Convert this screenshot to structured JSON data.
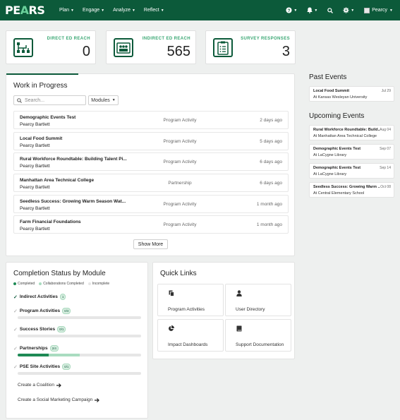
{
  "nav": {
    "logo_main": "PE",
    "logo_accent": "A",
    "logo_end": "RS",
    "menu": [
      {
        "label": "Plan"
      },
      {
        "label": "Engage"
      },
      {
        "label": "Analyze"
      },
      {
        "label": "Reflect"
      }
    ],
    "user_name": "Pearcy"
  },
  "stats": [
    {
      "label": "DIRECT ED REACH",
      "value": "0",
      "icon": "workflow-icon"
    },
    {
      "label": "INDIRECT ED REACH",
      "value": "565",
      "icon": "group-icon"
    },
    {
      "label": "SURVEY RESPONSES",
      "value": "3",
      "icon": "clipboard-icon"
    }
  ],
  "wip": {
    "title": "Work in Progress",
    "search_placeholder": "Search...",
    "filter_label": "Modules",
    "rows": [
      {
        "name": "Demographic Events Test",
        "owner": "Pearcy Bartlett",
        "type": "Program Activity",
        "time": "2 days ago"
      },
      {
        "name": "Local Food Summit",
        "owner": "Pearcy Bartlett",
        "type": "Program Activity",
        "time": "5 days ago"
      },
      {
        "name": "Rural Workforce Roundtable: Building Talent Pi...",
        "owner": "Pearcy Bartlett",
        "type": "Program Activity",
        "time": "6 days ago"
      },
      {
        "name": "Manhattan Area Technical College",
        "owner": "Pearcy Bartlett",
        "type": "Partnership",
        "time": "6 days ago"
      },
      {
        "name": "Seedless Success: Growing Warm Season Wat...",
        "owner": "Pearcy Bartlett",
        "type": "Program Activity",
        "time": "1 month ago"
      },
      {
        "name": "Farm Financial Foundations",
        "owner": "Pearcy Bartlett",
        "type": "Program Activity",
        "time": "1 month ago"
      }
    ],
    "show_more": "Show More"
  },
  "past_events": {
    "title": "Past Events",
    "items": [
      {
        "name": "Local Food Summit",
        "date": "Jul 29",
        "location": "At Kansas Wesleyan University"
      }
    ]
  },
  "upcoming_events": {
    "title": "Upcoming Events",
    "items": [
      {
        "name": "Rural Workforce Roundtable: Build...",
        "date": "Aug 04",
        "location": "At Manhattan Area Technical College"
      },
      {
        "name": "Demographic Events Test",
        "date": "Sep 07",
        "location": "At LaCygne Library"
      },
      {
        "name": "Demographic Events Test",
        "date": "Sep 14",
        "location": "At LaCygne Library"
      },
      {
        "name": "Seedless Success: Growing Warm ...",
        "date": "Oct 08",
        "location": "At Central Elementary School"
      }
    ]
  },
  "completion": {
    "title": "Completion Status by Module",
    "legend": [
      "Completed",
      "Collaborations Completed",
      "Incomplete"
    ],
    "colors": {
      "completed": "#1e8a55",
      "collab": "#a9dcc0",
      "incomplete": "#e6e6e6"
    },
    "modules": [
      {
        "label": "Indirect Activities",
        "badge": "1",
        "checked": true
      },
      {
        "label": "Program Activities",
        "badge": "0/3",
        "completed": 0,
        "collab": 0
      },
      {
        "label": "Success Stories",
        "badge": "0/1",
        "completed": 0,
        "collab": 0
      },
      {
        "label": "Partnerships",
        "badge": "2/4",
        "completed": 0.25,
        "collab": 0.25
      },
      {
        "label": "PSE Site Activities",
        "badge": "0/1",
        "completed": 0,
        "collab": 0
      }
    ],
    "links": [
      {
        "label": "Create a Coalition"
      },
      {
        "label": "Create a Social Marketing Campaign"
      }
    ]
  },
  "quick_links": {
    "title": "Quick Links",
    "items": [
      {
        "label": "Program Activities",
        "icon": "copy-icon"
      },
      {
        "label": "User Directory",
        "icon": "user-icon"
      },
      {
        "label": "Impact Dashboards",
        "icon": "pie-chart-icon"
      },
      {
        "label": "Support Documentation",
        "icon": "book-icon"
      }
    ]
  }
}
